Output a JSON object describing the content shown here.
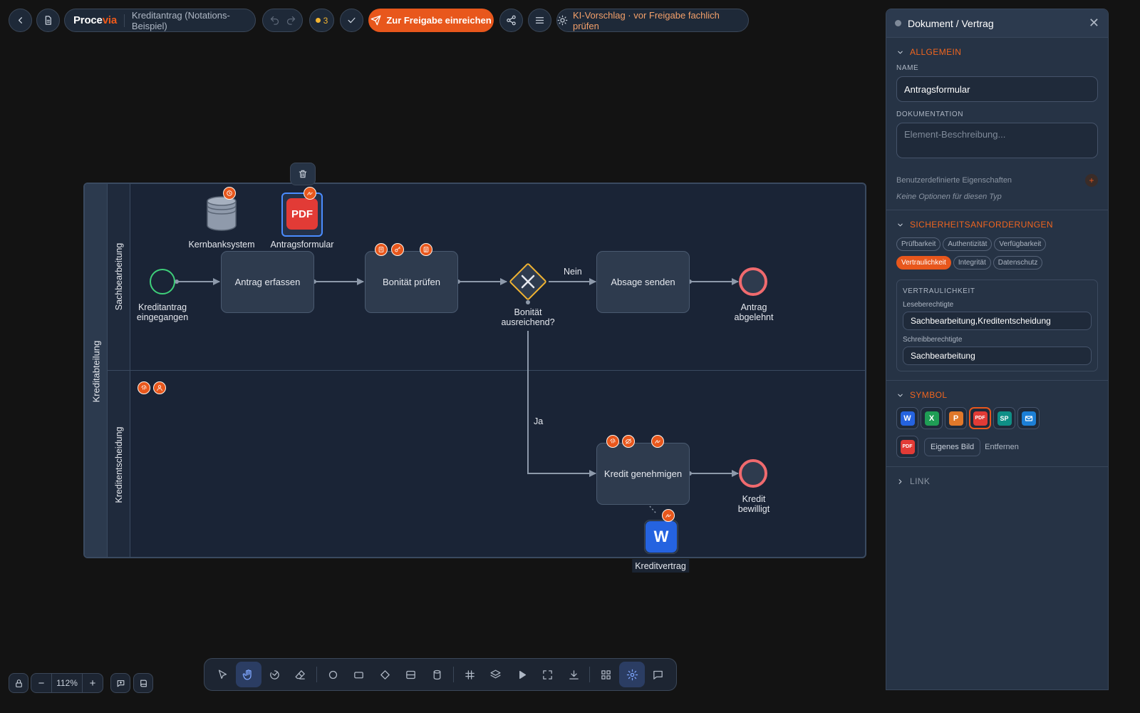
{
  "toolbar": {
    "brand_main": "Proce",
    "brand_accent": "via",
    "doc_title": "Kreditantrag (Notations-Beispiel)",
    "issue_count": "3",
    "submit_label": "Zur Freigabe einreichen",
    "ai_hint": "KI-Vorschlag · vor Freigabe fachlich prüfen"
  },
  "diagram": {
    "pool_name": "Kreditabteilung",
    "lanes": [
      "Sachbearbeitung",
      "Kreditentscheidung"
    ],
    "tasks": {
      "antrag_erfassen": "Antrag erfassen",
      "bonitaet_pruefen": "Bonität prüfen",
      "absage_senden": "Absage senden",
      "kredit_genehmigen": "Kredit genehmigen"
    },
    "events": {
      "start": "Kreditantrag\neingegangen",
      "end_rejected": "Antrag\nabgelehnt",
      "end_approved": "Kredit\nbewilligt"
    },
    "gateway": "Bonität\nausreichend?",
    "flow_labels": {
      "no": "Nein",
      "yes": "Ja"
    },
    "artifacts": {
      "datastore": "Kernbanksystem",
      "document_selected": "Antragsformular",
      "document_contract": "Kreditvertrag"
    },
    "icons": {
      "pdf_text": "PDF",
      "word_text": "W"
    },
    "colors": {
      "start_event": "#3ecf7a",
      "end_event": "#f06a6e",
      "gateway": "#f2b431",
      "accent": "#e8571c",
      "selection": "#4a8cff"
    }
  },
  "zoom": {
    "level": "112%"
  },
  "panel": {
    "title": "Dokument / Vertrag",
    "general": {
      "header": "ALLGEMEIN",
      "name_label": "NAME",
      "name_value": "Antragsformular",
      "doc_label": "DOKUMENTATION",
      "doc_placeholder": "Element-Beschreibung...",
      "custom_props": "Benutzerdefinierte Eigenschaften",
      "no_options": "Keine Optionen für diesen Typ"
    },
    "security": {
      "header": "SICHERHEITSANFORDERUNGEN",
      "chips": [
        "Prüfbarkeit",
        "Authentizität",
        "Verfügbarkeit",
        "Vertraulichkeit",
        "Integrität",
        "Datenschutz"
      ],
      "active_chip": "Vertraulichkeit",
      "box_title": "VERTRAULICHKEIT",
      "read_label": "Leseberechtigte",
      "read_value": "Sachbearbeitung,Kreditentscheidung",
      "write_label": "Schreibberechtigte",
      "write_value": "Sachbearbeitung"
    },
    "symbol": {
      "header": "SYMBOL",
      "options": [
        "W",
        "X",
        "P",
        "PDF",
        "SP",
        "mail-icon"
      ],
      "selected": "PDF",
      "custom_image": "Eigenes Bild",
      "remove": "Entfernen"
    },
    "link": {
      "header": "LINK"
    }
  }
}
